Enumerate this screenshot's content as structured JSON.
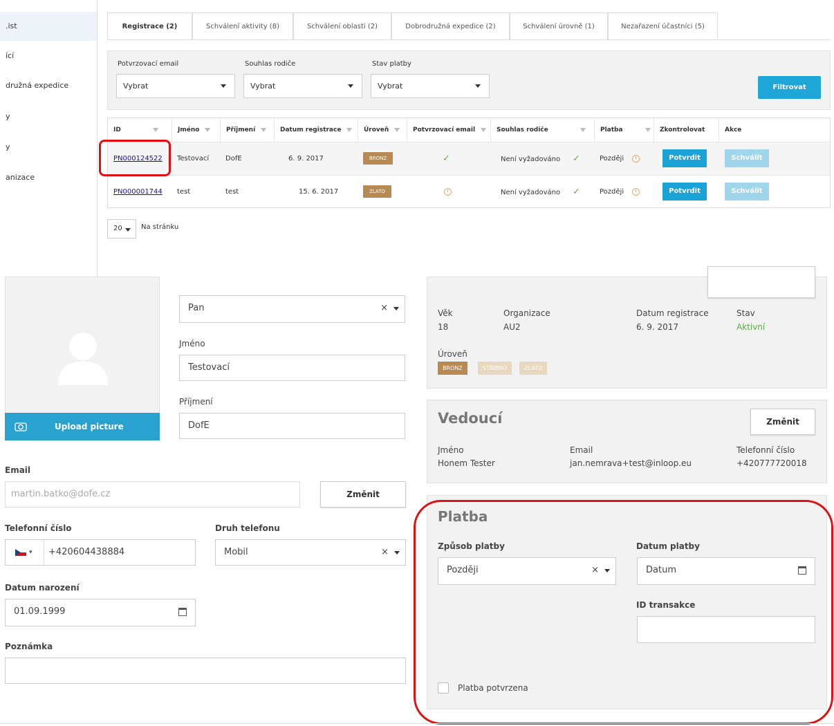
{
  "sidebar": {
    "items": [
      {
        "label": ".ist"
      },
      {
        "label": "ící"
      },
      {
        "label": "družná expedice"
      },
      {
        "label": "y"
      },
      {
        "label": "y"
      },
      {
        "label": "anizace"
      }
    ]
  },
  "tabs": [
    {
      "label": "Registrace (2)"
    },
    {
      "label": "Schválení aktivity (8)"
    },
    {
      "label": "Schválení oblasti (2)"
    },
    {
      "label": "Dobrodružná expedice (2)"
    },
    {
      "label": "Schválení úrovně (1)"
    },
    {
      "label": "Nezařazení účastníci (5)"
    }
  ],
  "filters": {
    "email_label": "Potvrzovací email",
    "email_value": "Vybrat",
    "consent_label": "Souhlas rodiče",
    "consent_value": "Vybrat",
    "payment_label": "Stav platby",
    "payment_value": "Vybrat",
    "filter_button": "Filtrovat"
  },
  "table": {
    "headers": [
      "ID",
      "Jméno",
      "Příjmení",
      "Datum registrace",
      "Úroveň",
      "Potvrzovací email",
      "Souhlas rodiče",
      "Platba",
      "Zkontrolovat",
      "Akce"
    ],
    "rows": [
      {
        "id": "PN000124522",
        "first": "Testovací",
        "last": "DofE",
        "date": "6. 9. 2017",
        "level": "BRONZ",
        "consent": "Není vyžadováno",
        "payment": "Později",
        "check_btn": "Potvrdit",
        "action_btn": "Schválit"
      },
      {
        "id": "PN000001744",
        "first": "test",
        "last": "test",
        "date": "15. 6. 2017",
        "level": "ZLATO",
        "consent": "Není vyžadováno",
        "payment": "Později",
        "check_btn": "Potvrdit",
        "action_btn": "Schválit"
      }
    ]
  },
  "pager": {
    "size": "20",
    "label": "Na stránku"
  },
  "profile": {
    "upload_label": "Upload picture",
    "salutation_value": "Pan",
    "first_name_label": "Jméno",
    "first_name_value": "Testovací",
    "last_name_label": "Příjmení",
    "last_name_value": "DofE",
    "email_label": "Email",
    "email_placeholder": "martin.batko@dofe.cz",
    "email_change": "Změnit",
    "phone_label": "Telefonní číslo",
    "phone_value": "+420604438884",
    "phone_type_label": "Druh telefonu",
    "phone_type_value": "Mobil",
    "dob_label": "Datum narození",
    "dob_value": "01.09.1999",
    "note_label": "Poznámka"
  },
  "info": {
    "age_label": "Věk",
    "age_value": "18",
    "org_label": "Organizace",
    "org_value": "AU2",
    "reg_label": "Datum registrace",
    "reg_value": "6. 9. 2017",
    "status_label": "Stav",
    "status_value": "Aktivní",
    "level_label": "Úroveň",
    "levels": [
      "BRONZ",
      "STŘÍBRO",
      "ZLATO"
    ]
  },
  "leader": {
    "title": "Vedoucí",
    "change": "Změnit",
    "name_label": "Jméno",
    "name_value": "Honem Tester",
    "email_label": "Email",
    "email_value": "jan.nemrava+test@inloop.eu",
    "phone_label": "Telefonní číslo",
    "phone_value": "+420777720018"
  },
  "payment": {
    "title": "Platba",
    "method_label": "Způsob platby",
    "method_value": "Později",
    "date_label": "Datum platby",
    "date_value": "Datum",
    "txn_label": "ID transakce",
    "confirmed_label": "Platba potvrzena"
  },
  "colors": {
    "accent": "#1fa6d8",
    "bronze": "#b88a52",
    "highlight": "#e01010",
    "status_green": "#5aa84a"
  }
}
